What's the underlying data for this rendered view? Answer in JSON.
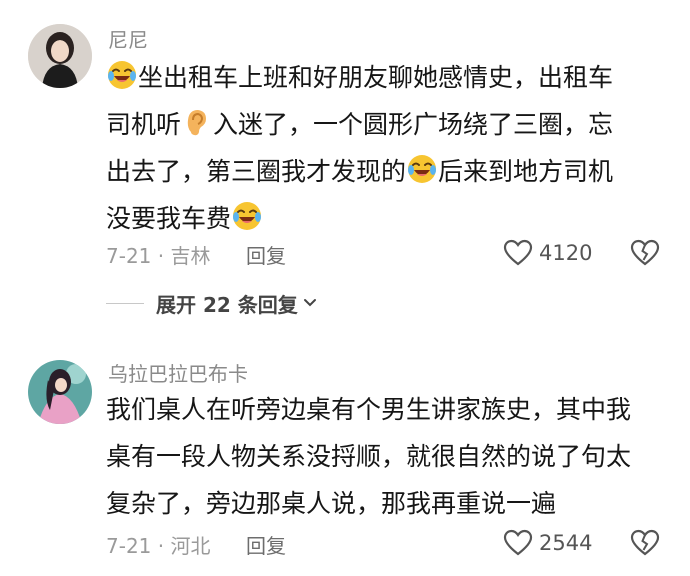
{
  "comments": [
    {
      "username": "尼尼",
      "segments": [
        "坐出租车上班和好朋友聊她感情史，出租车",
        "司机听",
        "入迷了，一个圆形广场绕了三圈，忘",
        "出去了，第三圈我才发现的",
        "后来到地方司机",
        "没要我车费"
      ],
      "date_location": "7-21 · 吉林",
      "reply_label": "回复",
      "likes": "4120",
      "expand_label": "展开 22 条回复"
    },
    {
      "username": "乌拉巴拉巴布卡",
      "lines": [
        "我们桌人在听旁边桌有个男生讲家族史，其中我",
        "桌有一段人物关系没捋顺，就很自然的说了句太",
        "复杂了，旁边那桌人说，那我再重说一遍"
      ],
      "date_location": "7-21 · 河北",
      "reply_label": "回复",
      "likes": "2544"
    }
  ],
  "icons": {
    "emoji": "crying-laughing-face-icon",
    "ear": "ear-icon",
    "like": "heart-outline-icon",
    "dislike": "broken-heart-icon",
    "expand": "chevron-down-icon"
  },
  "colors": {
    "username": "#8a8a8a",
    "body": "#161616",
    "meta": "#9a9a9a"
  }
}
